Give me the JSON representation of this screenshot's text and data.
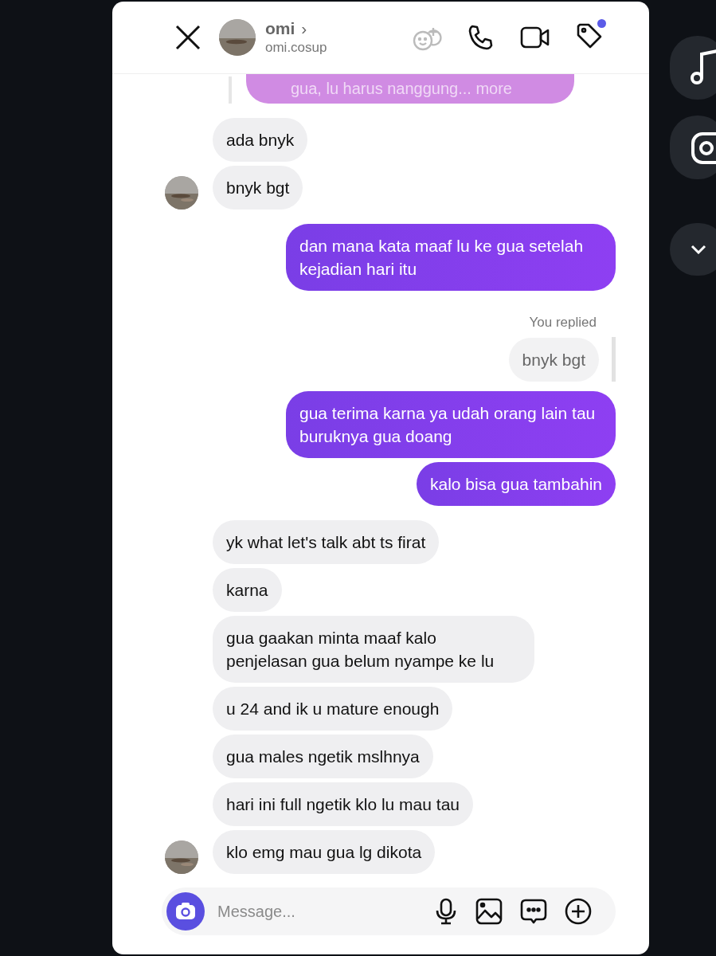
{
  "header": {
    "name": "omi",
    "chevron": "›",
    "username": "omi.cosup",
    "notification_dot": true
  },
  "messages": [
    {
      "kind": "quote",
      "text": "gua, lu harus nanggung... more"
    },
    {
      "kind": "in",
      "text": "ada bnyk",
      "avatar": false
    },
    {
      "kind": "in",
      "text": "bnyk bgt",
      "avatar": true
    },
    {
      "kind": "out",
      "text": "dan mana kata maaf lu ke gua setelah kejadian hari itu"
    },
    {
      "kind": "label",
      "text": "You replied"
    },
    {
      "kind": "reply",
      "text": "bnyk bgt"
    },
    {
      "kind": "out",
      "text": "gua terima karna ya udah orang lain tau buruknya gua doang"
    },
    {
      "kind": "out",
      "text": "kalo bisa gua tambahin"
    },
    {
      "kind": "in",
      "text": "yk what let's talk abt ts firat",
      "avatar": false
    },
    {
      "kind": "in",
      "text": "karna",
      "avatar": false
    },
    {
      "kind": "in",
      "text": "gua gaakan minta maaf kalo penjelasan gua belum nyampe ke lu",
      "avatar": false
    },
    {
      "kind": "in",
      "text": "u 24 and ik u mature enough",
      "avatar": false
    },
    {
      "kind": "in",
      "text": "gua males ngetik mslhnya",
      "avatar": false
    },
    {
      "kind": "in",
      "text": "hari ini full ngetik klo lu mau tau",
      "avatar": false
    },
    {
      "kind": "in",
      "text": "klo emg mau gua lg dikota",
      "avatar": true
    }
  ],
  "composer": {
    "placeholder": "Message..."
  }
}
